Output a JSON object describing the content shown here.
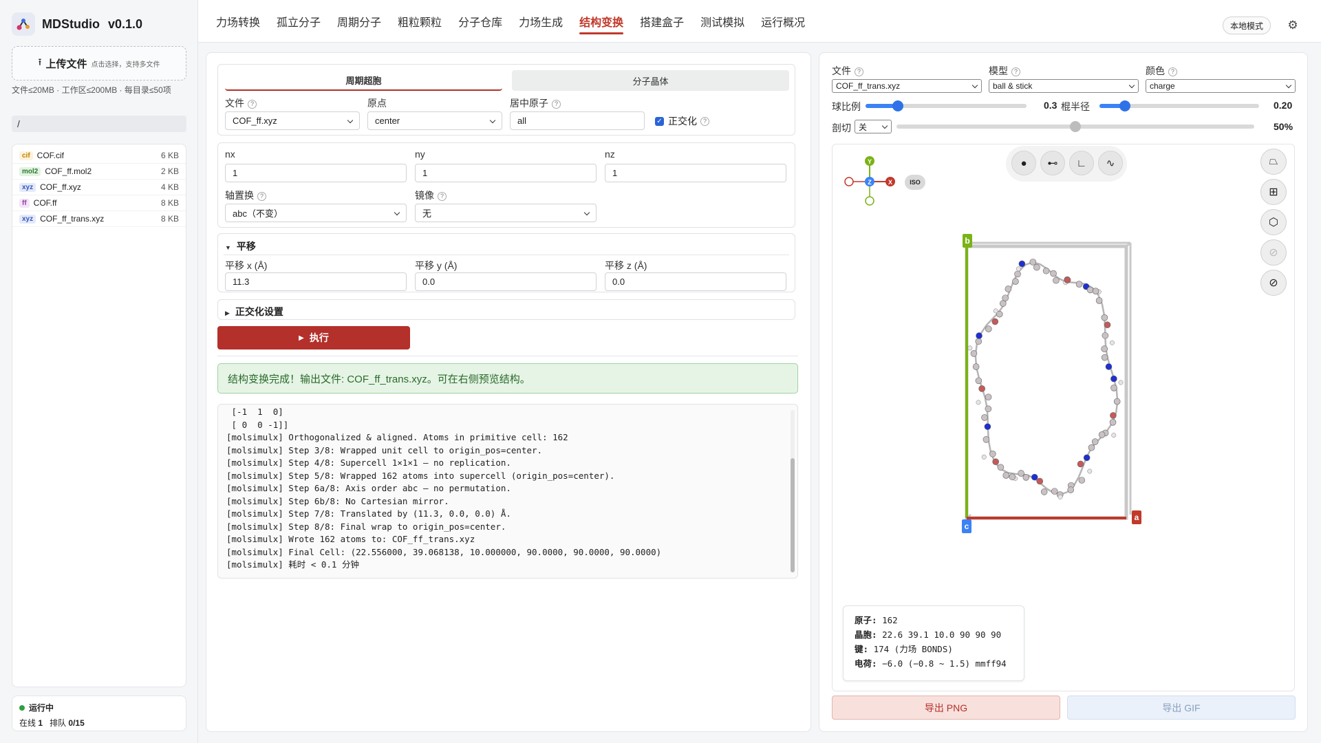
{
  "app": {
    "name": "MDStudio",
    "version": "v0.1.0"
  },
  "upload": {
    "label": "上传文件",
    "hint": "点击选择，支持多文件"
  },
  "limits": "文件≤20MB · 工作区≤200MB · 每目录≤50项",
  "path": "/",
  "files": [
    {
      "ext": "cif",
      "name": "COF.cif",
      "size": "6 KB"
    },
    {
      "ext": "mol2",
      "name": "COF_ff.mol2",
      "size": "2 KB"
    },
    {
      "ext": "xyz",
      "name": "COF_ff.xyz",
      "size": "4 KB"
    },
    {
      "ext": "ff",
      "name": "COF.ff",
      "size": "8 KB"
    },
    {
      "ext": "xyz",
      "name": "COF_ff_trans.xyz",
      "size": "8 KB"
    }
  ],
  "status": {
    "label": "运行中",
    "online_label": "在线",
    "online": "1",
    "queue_label": "排队",
    "queue": "0/15"
  },
  "nav": {
    "tabs": [
      "力场转换",
      "孤立分子",
      "周期分子",
      "粗粒颗粒",
      "分子仓库",
      "力场生成",
      "结构变换",
      "搭建盒子",
      "测试模拟",
      "运行概况"
    ],
    "active_index": 6,
    "mode": "本地模式"
  },
  "transform": {
    "modes": [
      "周期超胞",
      "分子晶体"
    ],
    "file_label": "文件",
    "file_value": "COF_ff.xyz",
    "origin_label": "原点",
    "origin_value": "center",
    "center_label": "居中原子",
    "center_value": "all",
    "ortho_label": "正交化",
    "nx_label": "nx",
    "nx": "1",
    "ny_label": "ny",
    "ny": "1",
    "nz_label": "nz",
    "nz": "1",
    "axis_label": "轴置换",
    "axis_value": "abc（不变）",
    "mirror_label": "镜像",
    "mirror_value": "无",
    "translate_title": "平移",
    "tx_label": "平移 x (Å)",
    "tx": "11.3",
    "ty_label": "平移 y (Å)",
    "ty": "0.0",
    "tz_label": "平移 z (Å)",
    "tz": "0.0",
    "ortho_settings_title": "正交化设置",
    "run_label": "执行",
    "success": "结构变换完成！输出文件: COF_ff_trans.xyz。可在右侧预览结构。"
  },
  "log": [
    " [-1  1  0]",
    " [ 0  0 -1]]",
    "[molsimulx] Orthogonalized & aligned. Atoms in primitive cell: 162",
    "[molsimulx] Step 3/8: Wrapped unit cell to origin_pos=center.",
    "[molsimulx] Step 4/8: Supercell 1×1×1 — no replication.",
    "[molsimulx] Step 5/8: Wrapped 162 atoms into supercell (origin_pos=center).",
    "[molsimulx] Step 6a/8: Axis order abc — no permutation.",
    "[molsimulx] Step 6b/8: No Cartesian mirror.",
    "[molsimulx] Step 7/8: Translated by (11.3, 0.0, 0.0) Å.",
    "[molsimulx] Step 8/8: Final wrap to origin_pos=center.",
    "[molsimulx] Wrote 162 atoms to: COF_ff_trans.xyz",
    "[molsimulx] Final Cell: (22.556000, 39.068138, 10.000000, 90.0000, 90.0000, 90.0000)",
    "[molsimulx] 耗时 < 0.1 分钟"
  ],
  "viewer": {
    "file_label": "文件",
    "file_value": "COF_ff_trans.xyz",
    "model_label": "模型",
    "model_value": "ball & stick",
    "color_label": "颜色",
    "color_value": "charge",
    "ball_label": "球比例",
    "ball_value": "0.3",
    "ball_fraction": 0.2,
    "bond_label": "棍半径",
    "bond_value": "0.20",
    "bond_fraction": 0.16,
    "clip_label": "剖切",
    "clip_value": "关",
    "clip_pct": "50%",
    "clip_fraction": 0.5,
    "axes": {
      "y": "Y",
      "z": "Z",
      "x": "X"
    },
    "iso": "ISO",
    "cell_labels": {
      "a": "a",
      "b": "b",
      "c": "c"
    },
    "info": {
      "atoms_label": "原子:",
      "atoms": "162",
      "cell_label": "晶胞:",
      "cell": "22.6 39.1 10.0 90 90 90",
      "bonds_label": "键:",
      "bonds": "174 (力场 BONDS)",
      "charge_label": "电荷:",
      "charge": "−6.0 (−0.8 ~ 1.5) mmff94"
    },
    "export_png": "导出 PNG",
    "export_gif": "导出 GIF"
  },
  "colors": {
    "accent": "#b4302a",
    "atom_c": "#c9c1c4",
    "atom_n": "#1f2fd0",
    "atom_o": "#c45a5a",
    "cell_a": "#c0392b",
    "cell_b": "#7ab317",
    "cell_c": "#3b82f6"
  }
}
